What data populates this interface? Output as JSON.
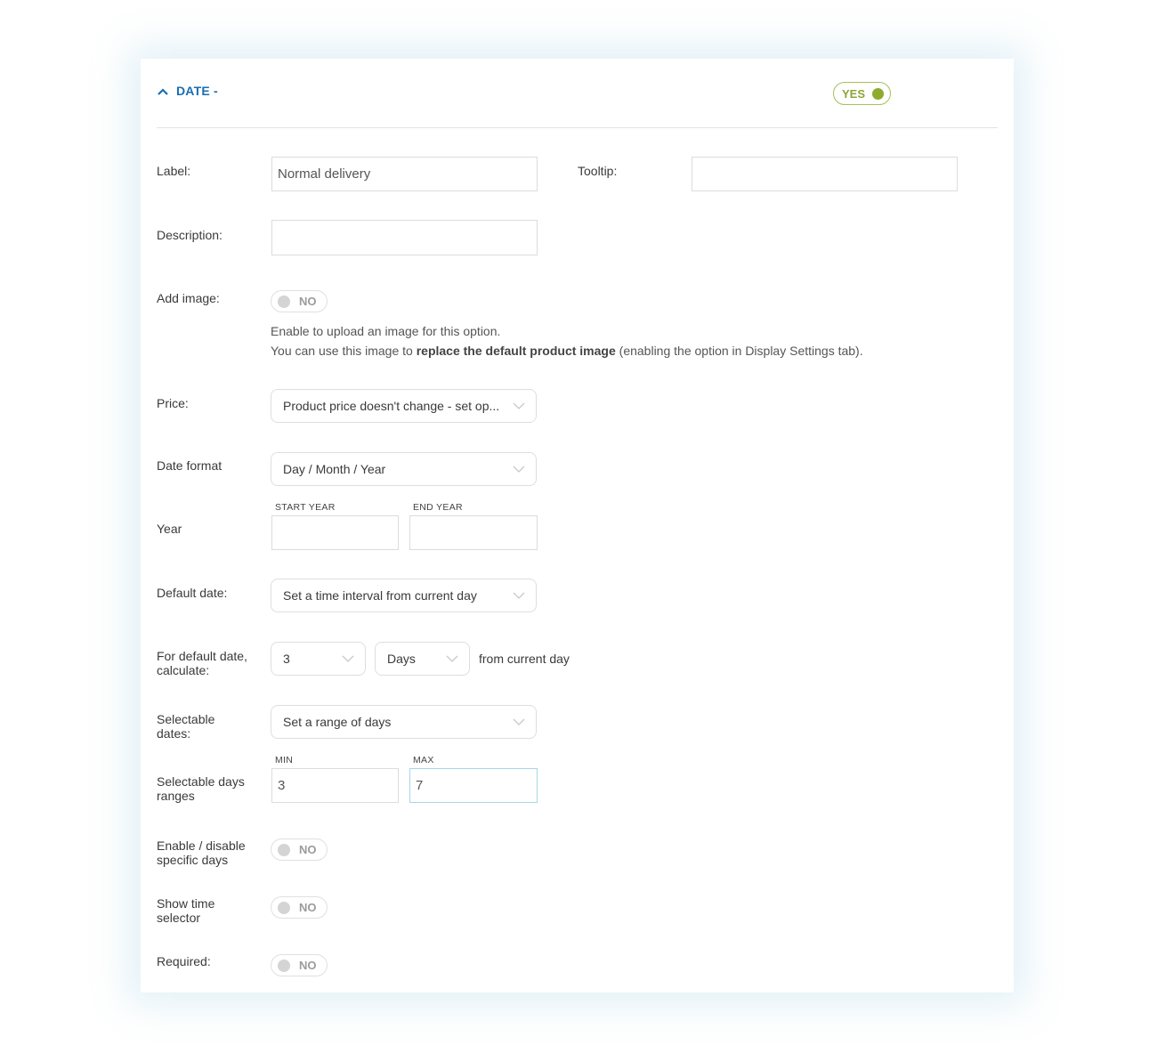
{
  "section": {
    "title": "DATE -",
    "enabled_toggle": {
      "label": "YES",
      "state": "on"
    },
    "colors": {
      "title": "#1a6eb0",
      "toggle_on": "#8eab2e",
      "toggle_off": "#d4d4d4",
      "focus_border": "#a9d6e5"
    }
  },
  "fields": {
    "label": {
      "label": "Label:",
      "value": "Normal delivery"
    },
    "tooltip": {
      "label": "Tooltip:",
      "value": ""
    },
    "description": {
      "label": "Description:",
      "value": ""
    },
    "add_image": {
      "label": "Add image:",
      "toggle": "NO",
      "help_line1": "Enable to upload an image for this option.",
      "help_line2_prefix": "You can use this image to ",
      "help_line2_bold": "replace the default product image",
      "help_line2_suffix": " (enabling the option in Display Settings tab)."
    },
    "price": {
      "label": "Price:",
      "selected": "Product price doesn't change - set op..."
    },
    "date_format": {
      "label": "Date format",
      "selected": "Day / Month / Year"
    },
    "year": {
      "label": "Year",
      "start_label": "START YEAR",
      "start_value": "",
      "end_label": "END YEAR",
      "end_value": ""
    },
    "default_date": {
      "label": "Default date:",
      "selected": "Set a time interval from current day"
    },
    "default_calc": {
      "label_line1": "For default date,",
      "label_line2": "calculate:",
      "amount": "3",
      "unit": "Days",
      "suffix": "from current day"
    },
    "selectable_dates": {
      "label_line1": "Selectable",
      "label_line2": "dates:",
      "selected": "Set a range of days"
    },
    "days_ranges": {
      "label_line1": "Selectable days",
      "label_line2": "ranges",
      "min_label": "MIN",
      "min_value": "3",
      "max_label": "MAX",
      "max_value": "7"
    },
    "specific_days": {
      "label_line1": "Enable / disable",
      "label_line2": "specific days",
      "toggle": "NO"
    },
    "time_selector": {
      "label_line1": "Show time",
      "label_line2": "selector",
      "toggle": "NO"
    },
    "required": {
      "label": "Required:",
      "toggle": "NO"
    }
  }
}
